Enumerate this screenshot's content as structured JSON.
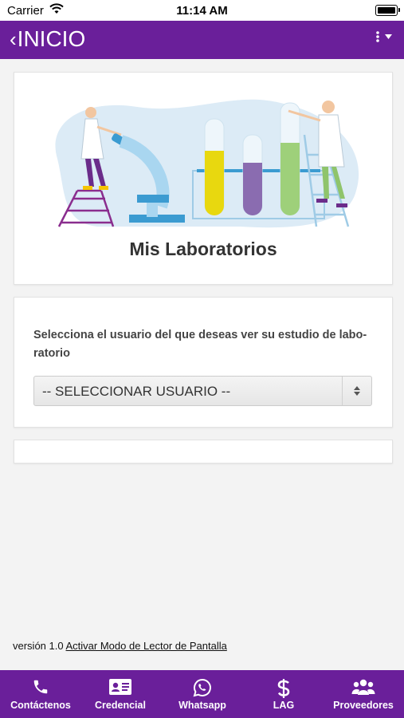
{
  "status_bar": {
    "carrier": "Carrier",
    "time": "11:14 AM"
  },
  "navbar": {
    "back_label": "INICIO",
    "background": "#6a1f9a"
  },
  "hero_card": {
    "title": "Mis Laboratorios"
  },
  "user_card": {
    "instruction": "Selecciona el usuario del que deseas ver su estudio de labo-ratorio",
    "select_value": "-- SELECCIONAR USUARIO --"
  },
  "footer": {
    "version_text": "versión 1.0",
    "accessibility_link": "Activar Modo de Lector de Pantalla"
  },
  "tabbar": {
    "items": [
      {
        "label": "Contáctenos",
        "icon": "phone-icon"
      },
      {
        "label": "Credencial",
        "icon": "id-card-icon"
      },
      {
        "label": "Whatsapp",
        "icon": "whatsapp-icon"
      },
      {
        "label": "LAG",
        "icon": "dollar-icon"
      },
      {
        "label": "Proveedores",
        "icon": "users-icon"
      }
    ]
  }
}
